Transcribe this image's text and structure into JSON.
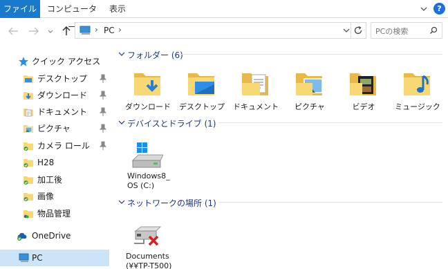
{
  "ribbon": {
    "tabs": [
      {
        "label": "ファイル",
        "active": true
      },
      {
        "label": "コンピューター",
        "active": false
      },
      {
        "label": "表示",
        "active": false
      }
    ],
    "help_label": "?"
  },
  "address": {
    "crumb": "PC",
    "search_placeholder": "PCの検索"
  },
  "sidebar": {
    "quick_access": "クイック アクセス",
    "items": [
      {
        "label": "デスクトップ",
        "pinned": true
      },
      {
        "label": "ダウンロード",
        "pinned": true
      },
      {
        "label": "ドキュメント",
        "pinned": true
      },
      {
        "label": "ピクチャ",
        "pinned": true
      },
      {
        "label": "カメラ ロール",
        "pinned": true
      },
      {
        "label": "H28",
        "pinned": false
      },
      {
        "label": "加工後",
        "pinned": false
      },
      {
        "label": "画像",
        "pinned": false
      },
      {
        "label": "物品管理",
        "pinned": false
      }
    ],
    "onedrive": "OneDrive",
    "pc": "PC"
  },
  "main": {
    "folders_header": "フォルダー (6)",
    "folders": [
      {
        "label": "ダウンロード",
        "icon": "download-folder-icon"
      },
      {
        "label": "デスクトップ",
        "icon": "desktop-folder-icon"
      },
      {
        "label": "ドキュメント",
        "icon": "documents-folder-icon"
      },
      {
        "label": "ピクチャ",
        "icon": "pictures-folder-icon"
      },
      {
        "label": "ビデオ",
        "icon": "videos-folder-icon"
      },
      {
        "label": "ミュージック",
        "icon": "music-folder-icon"
      }
    ],
    "devices_header": "デバイスとドライブ (1)",
    "drive": {
      "line1": "Windows8_",
      "line2": "OS (C:)"
    },
    "network_header": "ネットワークの場所 (1)",
    "network": {
      "line1": "Documents",
      "line2": "(¥¥TP-T500)"
    }
  },
  "colors": {
    "accent": "#1979ca",
    "selected_bg": "#cce4f7",
    "group_header": "#1e3287",
    "folder_yellow": "#f8d775"
  }
}
